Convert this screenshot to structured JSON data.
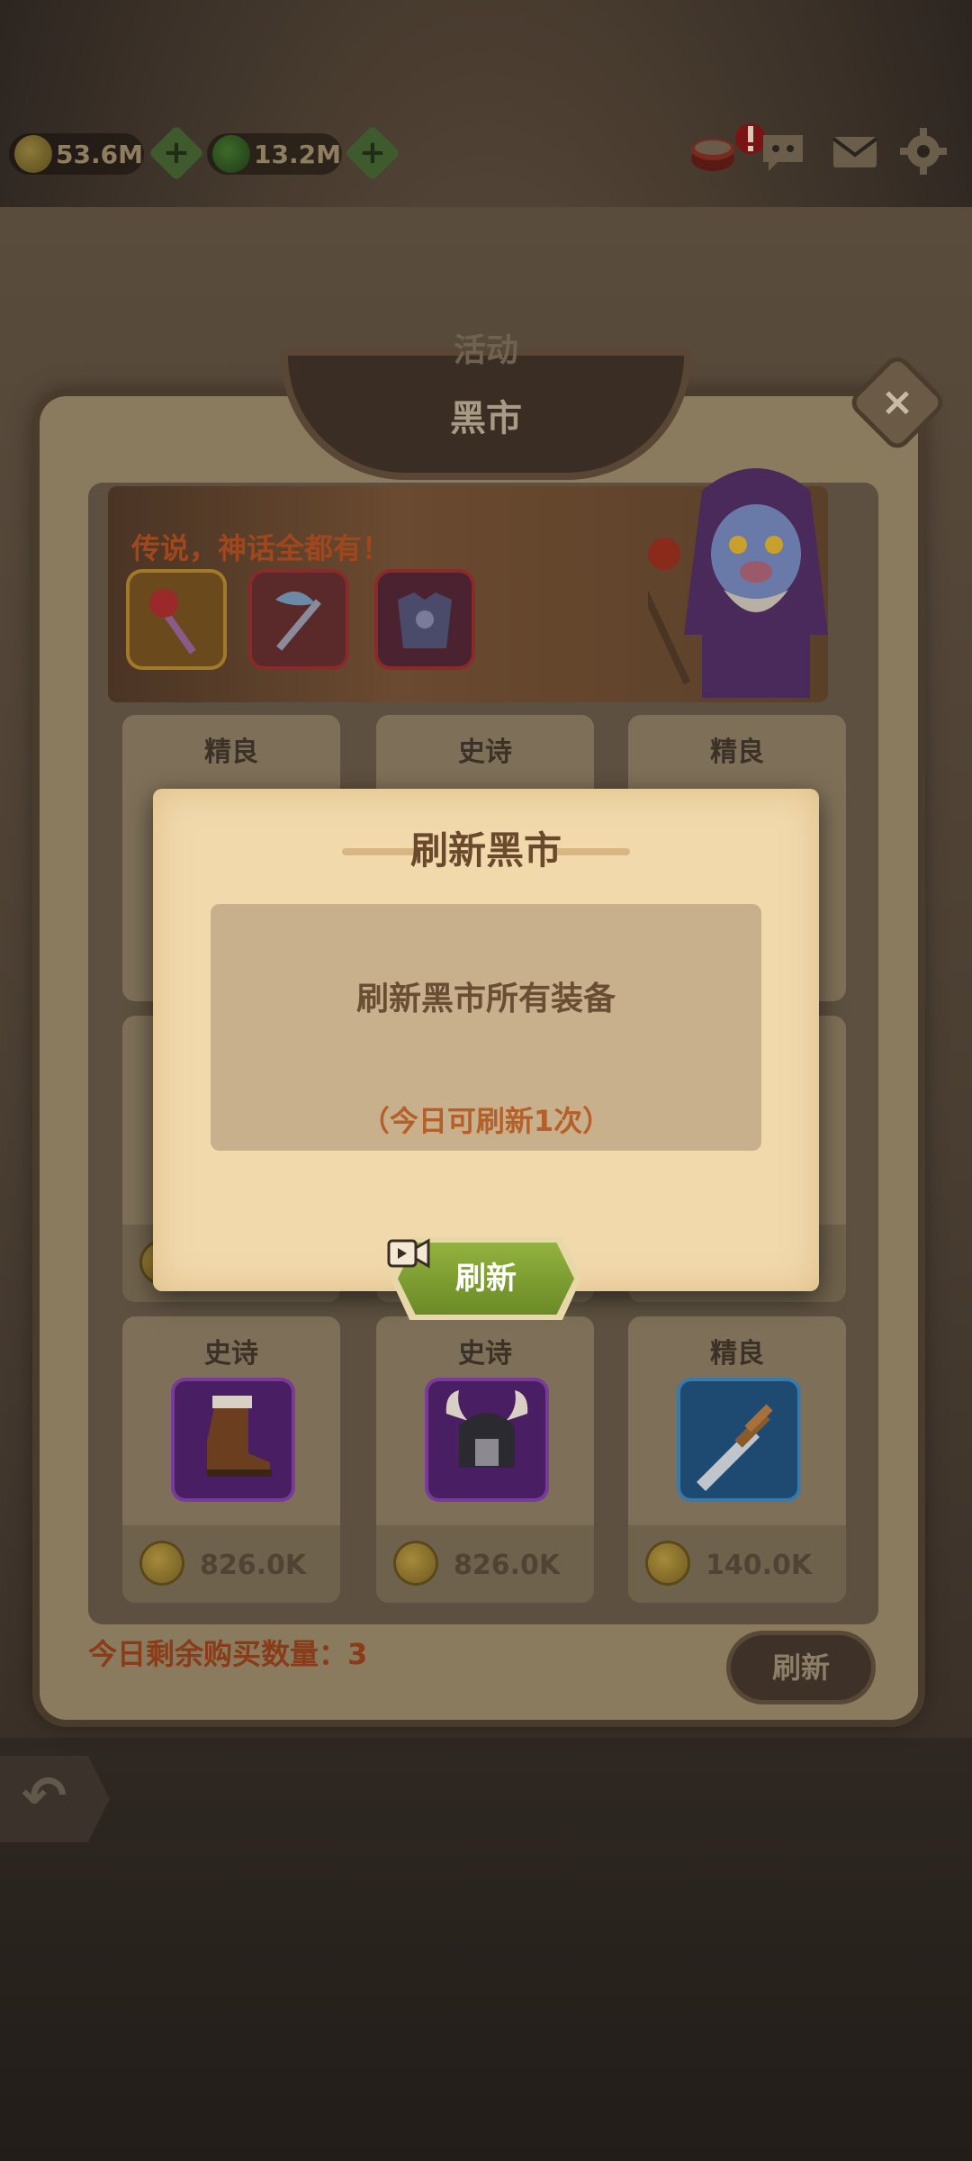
{
  "resources": {
    "gold": "53.6M",
    "gems": "13.2M"
  },
  "panel": {
    "activity_tab": "活动",
    "title": "黑市",
    "close_label": "×",
    "banner_text": "传说，神话全都有！"
  },
  "shop": {
    "items": [
      {
        "quality": "精良",
        "price": ""
      },
      {
        "quality": "史诗",
        "price": ""
      },
      {
        "quality": "精良",
        "price": ""
      },
      {
        "quality": "",
        "price": ""
      },
      {
        "quality": "",
        "price": ""
      },
      {
        "quality": "",
        "price": ""
      },
      {
        "quality": "史诗",
        "price": "826.0K",
        "icon": "boots-icon"
      },
      {
        "quality": "史诗",
        "price": "826.0K",
        "icon": "horned-helmet-icon"
      },
      {
        "quality": "精良",
        "price": "140.0K",
        "icon": "dagger-icon"
      }
    ],
    "remaining_label": "今日剩余购买数量：3",
    "refresh_label": "刷新"
  },
  "modal": {
    "title": "刷新黑市",
    "message": "刷新黑市所有装备",
    "sub": "（今日可刷新1次）",
    "button_label": "刷新"
  },
  "colors": {
    "modal_bg": "#f1d9ac",
    "button_green": "#7a9a30",
    "epic_purple": "#5b2a78",
    "rare_blue": "#2d5f86"
  }
}
